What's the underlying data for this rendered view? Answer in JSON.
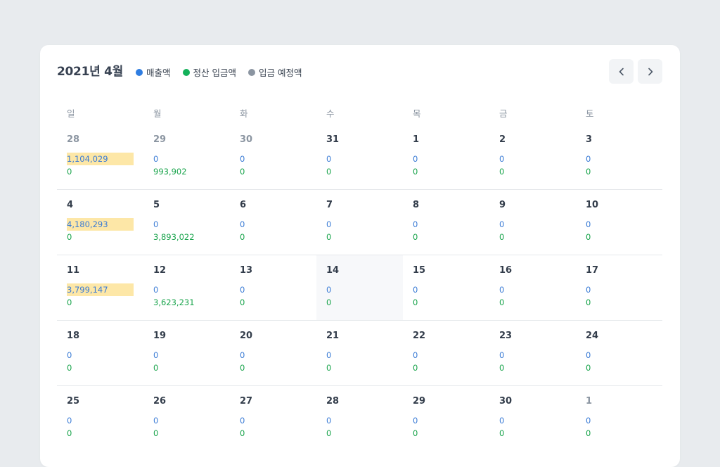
{
  "title": "2021년 4월",
  "legend": [
    {
      "label": "매출액",
      "color": "#2f7de1"
    },
    {
      "label": "정산 입금액",
      "color": "#14b15a"
    },
    {
      "label": "입금 예정액",
      "color": "#8b95a1"
    }
  ],
  "nav": {
    "prev_icon": "chevron-left-icon",
    "next_icon": "chevron-right-icon"
  },
  "weekdays": [
    "일",
    "월",
    "화",
    "수",
    "목",
    "금",
    "토"
  ],
  "colors": {
    "sales": "#3a7bd5",
    "settlement": "#17a34a",
    "highlight": "#fde7a7",
    "today_bg": "#f7f8fa"
  },
  "weeks": [
    [
      {
        "day": "28",
        "sales": "1,104,029",
        "settle": "0",
        "muted": true,
        "highlight": true
      },
      {
        "day": "29",
        "sales": "0",
        "settle": "993,902",
        "muted": true
      },
      {
        "day": "30",
        "sales": "0",
        "settle": "0",
        "muted": true
      },
      {
        "day": "31",
        "sales": "0",
        "settle": "0"
      },
      {
        "day": "1",
        "sales": "0",
        "settle": "0"
      },
      {
        "day": "2",
        "sales": "0",
        "settle": "0"
      },
      {
        "day": "3",
        "sales": "0",
        "settle": "0"
      }
    ],
    [
      {
        "day": "4",
        "sales": "4,180,293",
        "settle": "0",
        "highlight": true
      },
      {
        "day": "5",
        "sales": "0",
        "settle": "3,893,022"
      },
      {
        "day": "6",
        "sales": "0",
        "settle": "0"
      },
      {
        "day": "7",
        "sales": "0",
        "settle": "0"
      },
      {
        "day": "8",
        "sales": "0",
        "settle": "0"
      },
      {
        "day": "9",
        "sales": "0",
        "settle": "0"
      },
      {
        "day": "10",
        "sales": "0",
        "settle": "0"
      }
    ],
    [
      {
        "day": "11",
        "sales": "3,799,147",
        "settle": "0",
        "highlight": true
      },
      {
        "day": "12",
        "sales": "0",
        "settle": "3,623,231"
      },
      {
        "day": "13",
        "sales": "0",
        "settle": "0"
      },
      {
        "day": "14",
        "sales": "0",
        "settle": "0",
        "today": true
      },
      {
        "day": "15",
        "sales": "0",
        "settle": "0"
      },
      {
        "day": "16",
        "sales": "0",
        "settle": "0"
      },
      {
        "day": "17",
        "sales": "0",
        "settle": "0"
      }
    ],
    [
      {
        "day": "18",
        "sales": "0",
        "settle": "0"
      },
      {
        "day": "19",
        "sales": "0",
        "settle": "0"
      },
      {
        "day": "20",
        "sales": "0",
        "settle": "0"
      },
      {
        "day": "21",
        "sales": "0",
        "settle": "0"
      },
      {
        "day": "22",
        "sales": "0",
        "settle": "0"
      },
      {
        "day": "23",
        "sales": "0",
        "settle": "0"
      },
      {
        "day": "24",
        "sales": "0",
        "settle": "0"
      }
    ],
    [
      {
        "day": "25",
        "sales": "0",
        "settle": "0"
      },
      {
        "day": "26",
        "sales": "0",
        "settle": "0"
      },
      {
        "day": "27",
        "sales": "0",
        "settle": "0"
      },
      {
        "day": "28",
        "sales": "0",
        "settle": "0"
      },
      {
        "day": "29",
        "sales": "0",
        "settle": "0"
      },
      {
        "day": "30",
        "sales": "0",
        "settle": "0"
      },
      {
        "day": "1",
        "sales": "0",
        "settle": "0",
        "muted": true
      }
    ]
  ]
}
